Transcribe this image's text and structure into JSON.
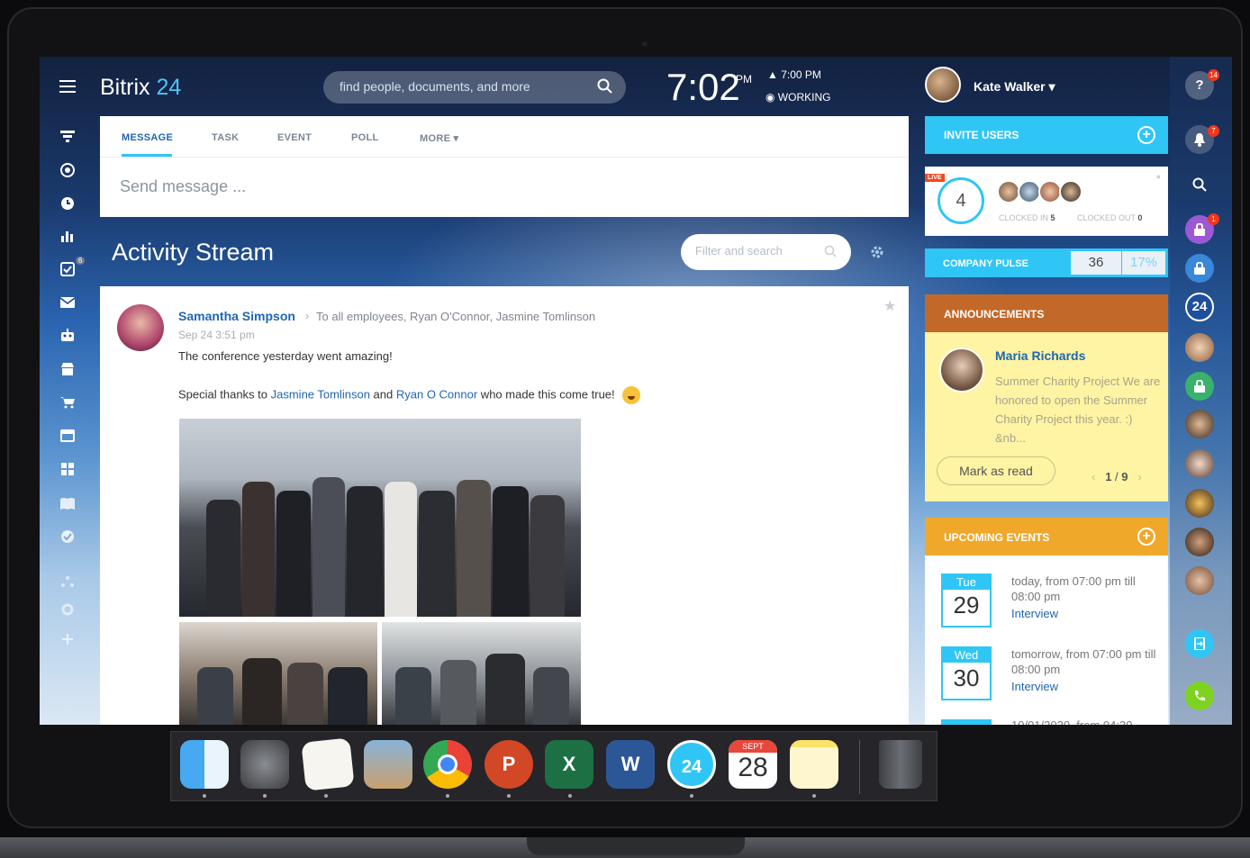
{
  "app": {
    "logo_text": "Bitrix",
    "logo_num": "24"
  },
  "header": {
    "search_placeholder": "find people, documents, and more",
    "clock": "7:02",
    "clock_pm": "PM",
    "status_time": "▲ 7:00 PM",
    "status_label": "◉ WORKING",
    "user_name": "Kate Walker ▾"
  },
  "composer": {
    "tabs": [
      "MESSAGE",
      "TASK",
      "EVENT",
      "POLL",
      "MORE ▾"
    ],
    "placeholder": "Send message ..."
  },
  "stream": {
    "title": "Activity Stream",
    "filter_placeholder": "Filter and search"
  },
  "post": {
    "author": "Samantha Simpson",
    "recipients": "To all employees, Ryan O'Connor, Jasmine Tomlinson",
    "date": "Sep 24 3:51 pm",
    "line1": "The conference yesterday went amazing!",
    "line2_prefix": "Special thanks to ",
    "line2_link1": "Jasmine Tomlinson",
    "line2_and": " and ",
    "line2_link2": "Ryan O Connor",
    "line2_suffix": " who made this come true!"
  },
  "widgets": {
    "invite_label": "INVITE USERS",
    "live_badge": "LIVE",
    "clocked_count": "4",
    "clocked_in_label": "CLOCKED IN",
    "clocked_in_value": "5",
    "clocked_out_label": "CLOCKED OUT",
    "clocked_out_value": "0",
    "company_pulse_label": "COMPANY PULSE",
    "company_pulse_value": "36",
    "company_pulse_pct": "17%",
    "announcements_label": "ANNOUNCEMENTS",
    "ann_author": "Maria Richards",
    "ann_text": "Summer Charity Project We are honored to open the Summer Charity Project this year. :) &nb...",
    "mark_read": "Mark as read",
    "ann_page": "1",
    "ann_total": "9",
    "events_label": "UPCOMING EVENTS",
    "events": [
      {
        "day": "Tue",
        "date": "29",
        "text": "today, from 07:00 pm till 08:00 pm",
        "type": "Interview"
      },
      {
        "day": "Wed",
        "date": "30",
        "text": "tomorrow, from 07:00 pm till 08:00 pm",
        "type": "Interview"
      },
      {
        "text": "10/01/2020, from 04:30"
      }
    ]
  },
  "rightbar": {
    "help_badge": "14",
    "notif_badge": "7",
    "lock_badge": "1",
    "b24_label": "24"
  },
  "leftbar": {
    "tasks_badge": "6"
  },
  "dock": {
    "calendar_month": "SEPT",
    "calendar_date": "28",
    "b24_label": "24",
    "ppt_label": "P",
    "excel_label": "X",
    "word_label": "W"
  },
  "colors": {
    "accent_blue": "#2fc6f6",
    "link_blue": "#2067b0",
    "announce_orange": "#c2692a",
    "events_orange": "#f0a82b"
  }
}
